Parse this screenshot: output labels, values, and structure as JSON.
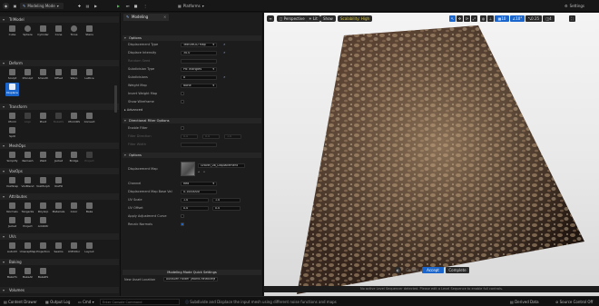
{
  "topbar": {
    "mode": "Modeling Mode",
    "platforms": "Platforms",
    "settings": "Settings"
  },
  "left": {
    "sections": [
      {
        "title": "TriModel",
        "tools": [
          "Cube",
          "Sphere",
          "Cylinder",
          "Cone",
          "Torus",
          "Stairs"
        ]
      },
      {
        "title": "Deform",
        "tools": [
          "Sculpt",
          "DSculpt",
          "Smooth",
          "Offset",
          "Warp",
          "Lattice",
          "Displace"
        ]
      },
      {
        "title": "Transform",
        "tools": [
          "Xform",
          "Align",
          "Pivot",
          "BakeRS",
          "XformRS",
          "Convert",
          "Split"
        ]
      },
      {
        "title": "MeshOps",
        "tools": [
          "Simplify",
          "Remesh",
          "Weld",
          "Jacket",
          "Bridge",
          "Project"
        ]
      },
      {
        "title": "VoxOps",
        "tools": [
          "VoxWrap",
          "VoxBlend",
          "VoxMorph",
          "VoxFill"
        ]
      },
      {
        "title": "Attributes",
        "tools": [
          "Normals",
          "Tangents",
          "PolyGrp",
          "Materials",
          "Color",
          "Bake",
          "Jacket",
          "Project",
          "AddAttr"
        ]
      },
      {
        "title": "UVs",
        "tools": [
          "AutoUV",
          "UnwrapMap",
          "Projection",
          "Seams",
          "UVEditor",
          "Layout"
        ]
      },
      {
        "title": "Baking",
        "tools": [
          "BakeTx",
          "BakeAll",
          "BakeRS"
        ]
      },
      {
        "title": "Volumes",
        "tools": []
      }
    ]
  },
  "details": {
    "tab": "Modeling",
    "options_title": "Options",
    "props": [
      {
        "label": "Displacement Type",
        "value": "Texture2D Map"
      },
      {
        "label": "Displace Intensity",
        "value": "30.0"
      },
      {
        "label": "Random Seed",
        "value": ""
      },
      {
        "label": "Subdivision Type",
        "value": "PN Triangles"
      },
      {
        "label": "Subdivisions",
        "value": "8"
      },
      {
        "label": "Weight Map",
        "value": "None"
      },
      {
        "label": "Invert Weight Map",
        "value": ""
      },
      {
        "label": "Show Wireframe",
        "value": ""
      }
    ],
    "advanced": "Advanced",
    "directional_title": "Directional Filter Options",
    "dir_props": [
      "Enable Filter",
      "Filter Direction",
      "Filter Width"
    ],
    "dir_values": [
      "0.0",
      "0.0",
      "1.0"
    ],
    "options2_title": "Options",
    "disp_map_label": "Displacement Map",
    "disp_map_value": "Gravel_06_Displacement",
    "props2": [
      {
        "label": "Channel",
        "value": "Red"
      },
      {
        "label": "Displacement Map Base Val",
        "value": "0.1000000"
      },
      {
        "label": "UV Scale",
        "value": "1.0"
      },
      {
        "label": "UV Offset",
        "value": "0.0"
      },
      {
        "label": "Apply Adjustment Curve",
        "value": ""
      },
      {
        "label": "Recalc Normals",
        "value": ""
      }
    ],
    "uv_scale_x": "1.0",
    "uv_scale_y": "1.0",
    "uv_offset_x": "0.0",
    "uv_offset_y": "0.0",
    "quick_settings": "Modeling Mode Quick Settings",
    "asset_location_label": "New Asset Location",
    "asset_location_value": "AutoGen Folder (World-Relative)"
  },
  "viewport": {
    "perspective": "Perspective",
    "lit": "Lit",
    "show": "Show",
    "scalability": "Scalability: High",
    "grid_value": "10",
    "angle_value": "10°",
    "scale_value": "0.25",
    "cam_value": "4",
    "cancel": "Cancel",
    "accept": "Accept",
    "complete": "Complete",
    "hint": "No active Level Sequencer detected. Please edit a Level Sequence to enable full controls."
  },
  "bottombar": {
    "content_drawer": "Content Drawer",
    "output_log": "Output Log",
    "cmd": "Cmd",
    "console_placeholder": "Enter Console Command",
    "status_message": "Subdivide and Displace the input mesh using different noise functions and maps",
    "derived_data": "Derived Data",
    "source_control": "Source Control Off"
  },
  "colors": {
    "accent": "#1a66cc",
    "scalability": "#d8c84a",
    "accent_green": "#4ab84a"
  }
}
